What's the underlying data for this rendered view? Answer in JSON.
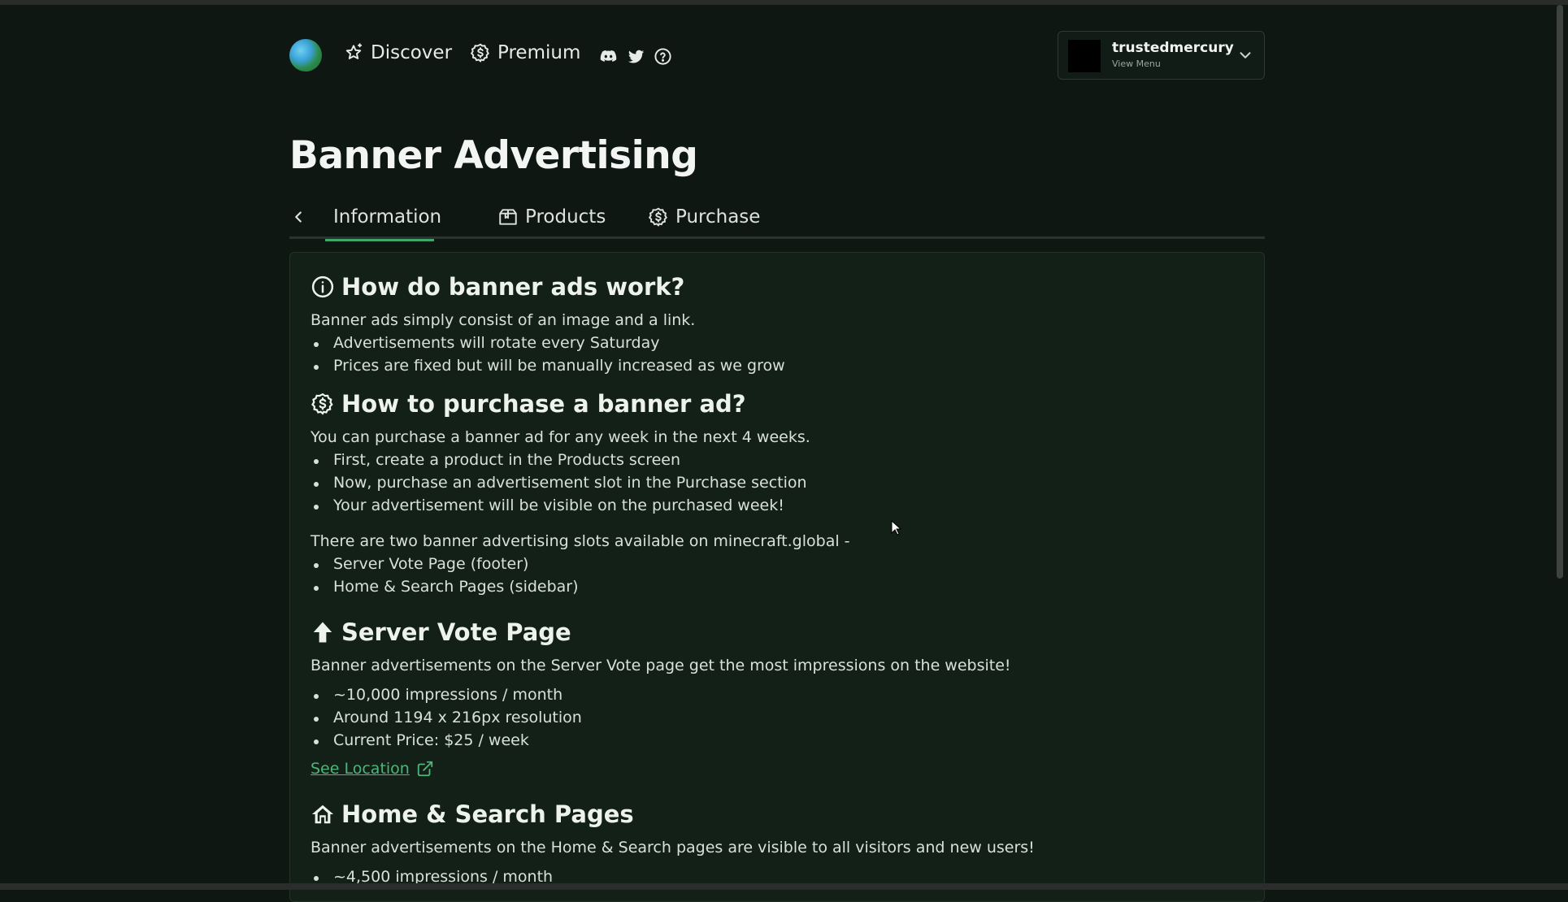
{
  "nav": {
    "discover_label": "Discover",
    "premium_label": "Premium",
    "social_icons": [
      "discord-icon",
      "twitter-icon",
      "help-icon"
    ],
    "user": {
      "name": "trustedmercury",
      "sub": "View Menu"
    }
  },
  "page": {
    "title": "Banner Advertising"
  },
  "tabs": [
    {
      "label": "Information",
      "icon": "info-icon",
      "active": true
    },
    {
      "label": "Products",
      "icon": "box-icon",
      "active": false
    },
    {
      "label": "Purchase",
      "icon": "dollar-icon",
      "active": false
    }
  ],
  "sections": {
    "how_work": {
      "heading": "How do banner ads work?",
      "intro": "Banner ads simply consist of an image and a link.",
      "bullets": [
        "Advertisements will rotate every Saturday",
        "Prices are fixed but will be manually increased as we grow"
      ]
    },
    "how_purchase": {
      "heading": "How to purchase a banner ad?",
      "intro": "You can purchase a banner ad for any week in the next 4 weeks.",
      "bullets": [
        "First, create a product in the Products screen",
        "Now, purchase an advertisement slot in the Purchase section",
        "Your advertisement will be visible on the purchased week!"
      ],
      "slots_intro": "There are two banner advertising slots available on minecraft.global -",
      "slots": [
        "Server Vote Page (footer)",
        "Home & Search Pages (sidebar)"
      ]
    },
    "vote_page": {
      "heading": "Server Vote Page",
      "intro": "Banner advertisements on the Server Vote page get the most impressions on the website!",
      "bullets": [
        "~10,000 impressions / month",
        "Around 1194 x 216px resolution",
        "Current Price: $25 / week"
      ],
      "link": "See Location"
    },
    "home_search": {
      "heading": "Home & Search Pages",
      "intro": "Banner advertisements on the Home & Search pages are visible to all visitors and new users!",
      "bullets": [
        "~4,500 impressions / month"
      ]
    }
  },
  "colors": {
    "background": "#0e1712",
    "card": "#122017",
    "accent": "#3fa56b",
    "link": "#4fb47a"
  }
}
